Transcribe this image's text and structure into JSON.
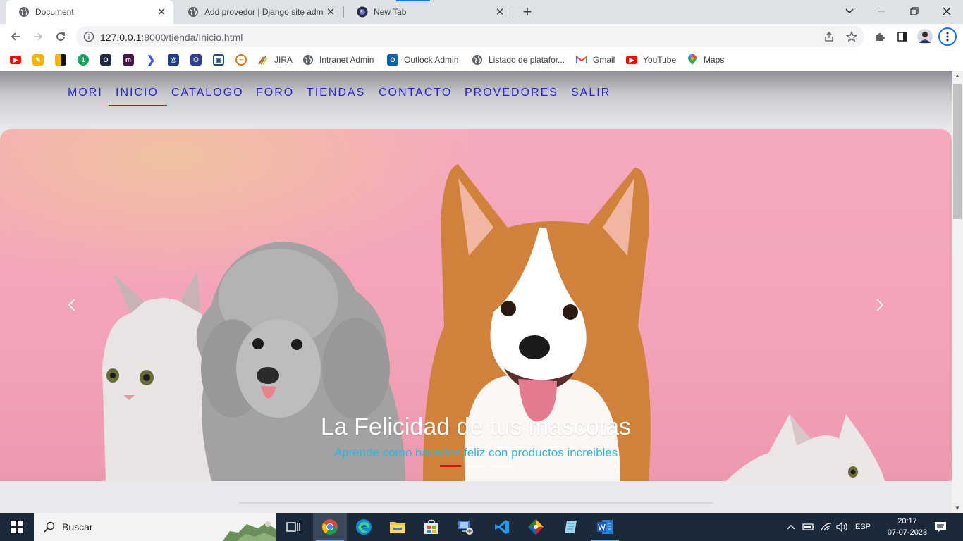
{
  "browser": {
    "tabs": [
      {
        "title": "Document",
        "favicon": "globe-icon",
        "active": true
      },
      {
        "title": "Add provedor | Django site admi",
        "favicon": "globe-icon",
        "active": false
      },
      {
        "title": "New Tab",
        "favicon": "chrome-newtab-icon",
        "active": false
      }
    ],
    "url_host": "127.0.0.1",
    "url_path": ":8000/tienda/Inicio.html",
    "bookmarks": [
      {
        "label": "",
        "icon": "youtube-icon",
        "color": "#ff0000"
      },
      {
        "label": "",
        "icon": "pencil-app-icon",
        "color": "#f4b400"
      },
      {
        "label": "",
        "icon": "bars-app-icon",
        "color": "#f4b400"
      },
      {
        "label": "",
        "icon": "one-app-icon",
        "color": "#1aa260"
      },
      {
        "label": "",
        "icon": "o-app-icon",
        "color": "#1f2a44"
      },
      {
        "label": "",
        "icon": "m-app-icon",
        "color": "#4a154b"
      },
      {
        "label": "",
        "icon": "arrow-app-icon",
        "color": "#3d5afe"
      },
      {
        "label": "",
        "icon": "at-app-icon",
        "color": "#1f3c88"
      },
      {
        "label": "",
        "icon": "person-app-icon",
        "color": "#2d3f8f"
      },
      {
        "label": "",
        "icon": "box-app-icon",
        "color": "#1f4e79"
      },
      {
        "label": "",
        "icon": "wave-app-icon",
        "color": "#e8710a"
      },
      {
        "label": "JIRA",
        "icon": "jira-icon",
        "color": "#2684ff"
      },
      {
        "label": "Intranet Admin",
        "icon": "globe-icon",
        "color": "#5f6368"
      },
      {
        "label": "Outlock Admin",
        "icon": "outlook-icon",
        "color": "#0a64ad"
      },
      {
        "label": "Listado de platafor...",
        "icon": "globe-icon",
        "color": "#5f6368"
      },
      {
        "label": "Gmail",
        "icon": "gmail-icon",
        "color": "#ea4335"
      },
      {
        "label": "YouTube",
        "icon": "youtube-icon",
        "color": "#ff0000"
      },
      {
        "label": "Maps",
        "icon": "maps-pin-icon",
        "color": "#34a853"
      }
    ]
  },
  "page": {
    "nav": [
      "MORI",
      "INICIO",
      "CATALOGO",
      "FORO",
      "TIENDAS",
      "CONTACTO",
      "PROVEDORES",
      "SALIR"
    ],
    "nav_active": "INICIO",
    "hero": {
      "title": "La Felicidad de tus mascotas",
      "subtitle": "Aprende como hacerlos feliz con productos increibles",
      "slides": 3,
      "active_slide": 1
    }
  },
  "taskbar": {
    "search_placeholder": "Buscar",
    "language": "ESP",
    "time": "20:17",
    "date": "07-07-2023"
  }
}
